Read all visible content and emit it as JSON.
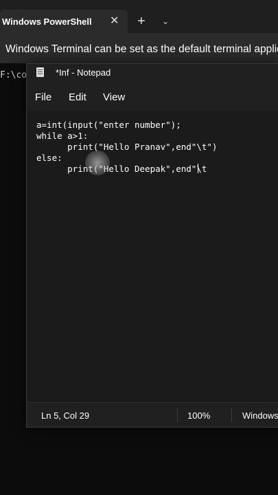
{
  "terminal": {
    "tab_title": "Windows PowerShell",
    "close_glyph": "✕",
    "new_tab_glyph": "+",
    "dropdown_glyph": "⌄",
    "info_message": "Windows Terminal can be set as the default terminal application",
    "prompt_fragment": "F:\\cod"
  },
  "notepad": {
    "title": "*Inf - Notepad",
    "menu": [
      "File",
      "Edit",
      "View"
    ],
    "code_lines": [
      "a=int(input(\"enter number\");",
      "while a>1:",
      "      print(\"Hello Pranav\",end\"\\t\")",
      "else:",
      "      print(\"Hello Deepak\",end\"\\t"
    ],
    "status": {
      "position": "Ln 5, Col 29",
      "zoom": "100%",
      "line_ending": "Windows (CRLF)"
    }
  }
}
